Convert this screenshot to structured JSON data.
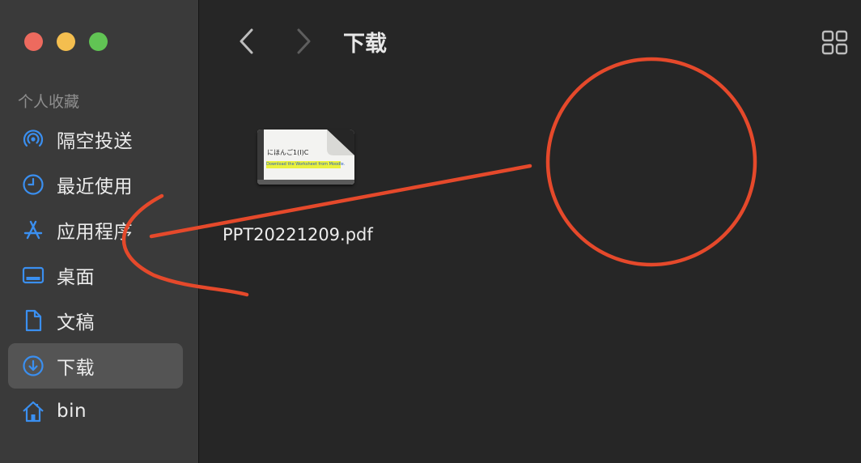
{
  "sidebar": {
    "section_title": "个人收藏",
    "items": [
      {
        "label": "隔空投送",
        "icon": "airdrop-icon"
      },
      {
        "label": "最近使用",
        "icon": "clock-icon"
      },
      {
        "label": "应用程序",
        "icon": "applications-icon"
      },
      {
        "label": "桌面",
        "icon": "desktop-icon"
      },
      {
        "label": "文稿",
        "icon": "document-icon"
      },
      {
        "label": "下载",
        "icon": "download-icon",
        "active": true
      },
      {
        "label": "bin",
        "icon": "home-icon"
      }
    ]
  },
  "toolbar": {
    "title": "下载",
    "back_icon": "chevron-left-icon",
    "forward_icon": "chevron-right-icon",
    "view_icon": "grid-view-icon"
  },
  "files": [
    {
      "name": "PPT20221209.pdf",
      "thumb_title": "にほんご1(I)C",
      "thumb_highlight": "Download the Worksheet from Moodle."
    }
  ],
  "colors": {
    "accent_blue": "#3a8ff0",
    "annotation_red": "#e5492b",
    "sidebar_bg": "#3a3a3a",
    "content_bg": "#262626"
  }
}
